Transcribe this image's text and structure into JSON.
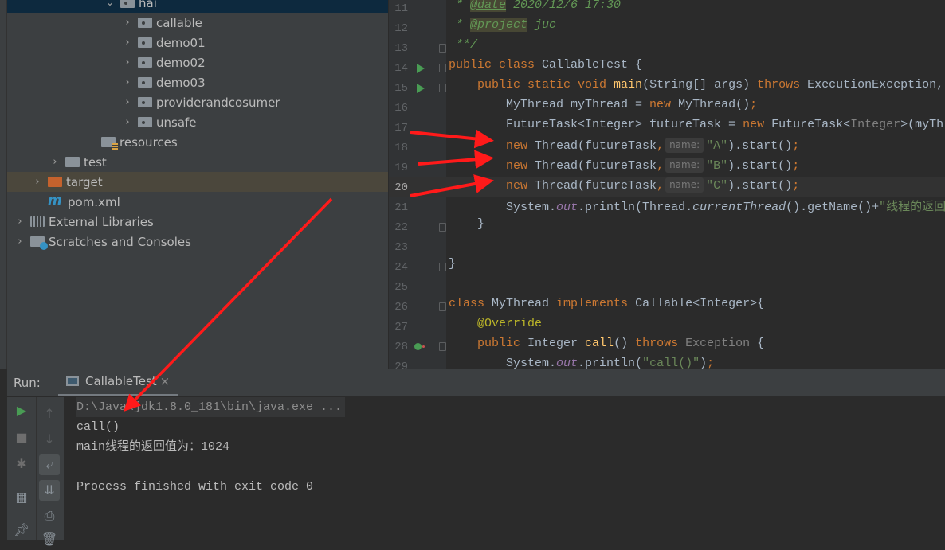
{
  "tree": [
    {
      "label": "hai",
      "chev": "⌄",
      "icon": "pkg",
      "indent": 122,
      "state": "sel"
    },
    {
      "label": "callable",
      "chev": "›",
      "icon": "pkg",
      "indent": 144
    },
    {
      "label": "demo01",
      "chev": "›",
      "icon": "pkg",
      "indent": 144
    },
    {
      "label": "demo02",
      "chev": "›",
      "icon": "pkg",
      "indent": 144
    },
    {
      "label": "demo03",
      "chev": "›",
      "icon": "pkg",
      "indent": 144
    },
    {
      "label": "providerandcosumer",
      "chev": "›",
      "icon": "pkg",
      "indent": 144
    },
    {
      "label": "unsafe",
      "chev": "›",
      "icon": "pkg",
      "indent": 144
    },
    {
      "label": "resources",
      "chev": "",
      "icon": "res",
      "indent": 98
    },
    {
      "label": "test",
      "chev": "›",
      "icon": "",
      "indent": 53
    },
    {
      "label": "target",
      "chev": "›",
      "icon": "orange",
      "indent": 31,
      "state": "hl"
    },
    {
      "label": "pom.xml",
      "chev": "",
      "icon": "m",
      "indent": 31
    },
    {
      "label": "External Libraries",
      "chev": "›",
      "icon": "lib",
      "indent": 9
    },
    {
      "label": "Scratches and Consoles",
      "chev": "›",
      "icon": "scr",
      "indent": 9
    }
  ],
  "editor": {
    "current_line": 20,
    "lines": [
      {
        "n": 11,
        "t": [
          [
            "cm",
            " * "
          ],
          [
            "tag",
            "@date"
          ],
          [
            "cm",
            " 2020/12/6 17:30"
          ]
        ]
      },
      {
        "n": 12,
        "t": [
          [
            "cm",
            " * "
          ],
          [
            "tag",
            "@project"
          ],
          [
            "cm",
            " juc"
          ]
        ]
      },
      {
        "n": 13,
        "t": [
          [
            "cm",
            " **/"
          ]
        ]
      },
      {
        "n": 14,
        "t": [
          [
            "kw",
            "public class "
          ],
          [
            "",
            "CallableTest {"
          ]
        ]
      },
      {
        "n": 15,
        "t": [
          [
            "kw",
            "    public static void "
          ],
          [
            "mt",
            "main"
          ],
          [
            "",
            "(String[] args) "
          ],
          [
            "kw",
            "throws "
          ],
          [
            "",
            "ExecutionException,"
          ]
        ]
      },
      {
        "n": 16,
        "t": [
          [
            "",
            "        MyThread myThread = "
          ],
          [
            "kw",
            "new "
          ],
          [
            "",
            "MyThread()"
          ],
          [
            "kw",
            ";"
          ]
        ]
      },
      {
        "n": 17,
        "t": [
          [
            "",
            "        FutureTask<Integer> futureTask = "
          ],
          [
            "kw",
            "new "
          ],
          [
            "",
            "FutureTask<"
          ],
          [
            "gray",
            "Integer"
          ],
          [
            "",
            ">(myThread);"
          ]
        ]
      },
      {
        "n": 18,
        "t": [
          [
            "kw",
            "        new "
          ],
          [
            "",
            "Thread(futureTask"
          ],
          [
            "kw",
            ","
          ],
          [
            "hint",
            "name:"
          ],
          [
            "str",
            "\"A\""
          ],
          [
            "",
            ").start()"
          ],
          [
            "kw",
            ";"
          ]
        ]
      },
      {
        "n": 19,
        "t": [
          [
            "kw",
            "        new "
          ],
          [
            "",
            "Thread(futureTask"
          ],
          [
            "kw",
            ","
          ],
          [
            "hint",
            "name:"
          ],
          [
            "str",
            "\"B\""
          ],
          [
            "",
            ").start()"
          ],
          [
            "kw",
            ";"
          ]
        ]
      },
      {
        "n": 20,
        "t": [
          [
            "kw",
            "        new "
          ],
          [
            "",
            "Thread(futureTask"
          ],
          [
            "kw",
            ","
          ],
          [
            "hint",
            "name:"
          ],
          [
            "str",
            "\"C\""
          ],
          [
            "",
            ").start()"
          ],
          [
            "kw",
            ";"
          ]
        ]
      },
      {
        "n": 21,
        "t": [
          [
            "",
            "        System."
          ],
          [
            "fld",
            "out"
          ],
          [
            "",
            ".println(Thread."
          ],
          [
            "st",
            "currentThread"
          ],
          [
            "",
            "().getName()+"
          ],
          [
            "str",
            "\"线程的返回值为："
          ]
        ]
      },
      {
        "n": 22,
        "t": [
          [
            "",
            "    }"
          ]
        ]
      },
      {
        "n": 23,
        "t": []
      },
      {
        "n": 24,
        "t": [
          [
            "",
            "}"
          ]
        ]
      },
      {
        "n": 25,
        "t": []
      },
      {
        "n": 26,
        "t": [
          [
            "kw",
            "class "
          ],
          [
            "",
            "MyThread "
          ],
          [
            "kw",
            "implements "
          ],
          [
            "",
            "Callable<Integer>{"
          ]
        ]
      },
      {
        "n": 27,
        "t": [
          [
            "ann",
            "    @Override"
          ]
        ]
      },
      {
        "n": 28,
        "t": [
          [
            "kw",
            "    public "
          ],
          [
            "",
            "Integer "
          ],
          [
            "mt",
            "call"
          ],
          [
            "",
            "() "
          ],
          [
            "kw",
            "throws "
          ],
          [
            "gray",
            "Exception "
          ],
          [
            "",
            "{"
          ]
        ]
      },
      {
        "n": 29,
        "t": [
          [
            "",
            "        System."
          ],
          [
            "fld",
            "out"
          ],
          [
            "",
            ".println("
          ],
          [
            "str",
            "\"call()\""
          ],
          [
            "",
            ")"
          ],
          [
            "kw",
            ";"
          ]
        ]
      }
    ]
  },
  "run": {
    "label": "Run:",
    "tab": "CallableTest",
    "close": "×",
    "console": [
      "D:\\Java\\jdk1.8.0_181\\bin\\java.exe ...",
      "call()",
      "main线程的返回值为：1024",
      "",
      "Process finished with exit code 0"
    ]
  },
  "colors": {
    "keyword": "#cc7832",
    "string": "#6a8759",
    "annotation_arrow": "#ff1a1a",
    "run_green": "#499c54"
  }
}
